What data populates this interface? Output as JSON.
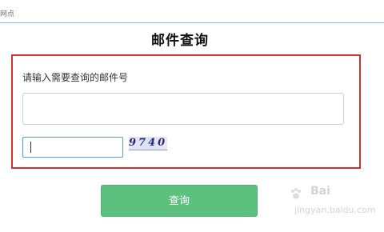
{
  "topbar": {
    "text": "网点"
  },
  "page": {
    "title": "邮件查询"
  },
  "form": {
    "prompt": "请输入需要查询的邮件号",
    "tracking_value": "",
    "captcha_value": "",
    "captcha_code": "9740",
    "submit_label": "查询"
  },
  "watermark": {
    "brand": "Bai",
    "url": "jingyan.baidu.com"
  },
  "colors": {
    "panel_border": "#cc3333",
    "button": "#5cc17e",
    "focus_border": "#5b9bd5"
  }
}
